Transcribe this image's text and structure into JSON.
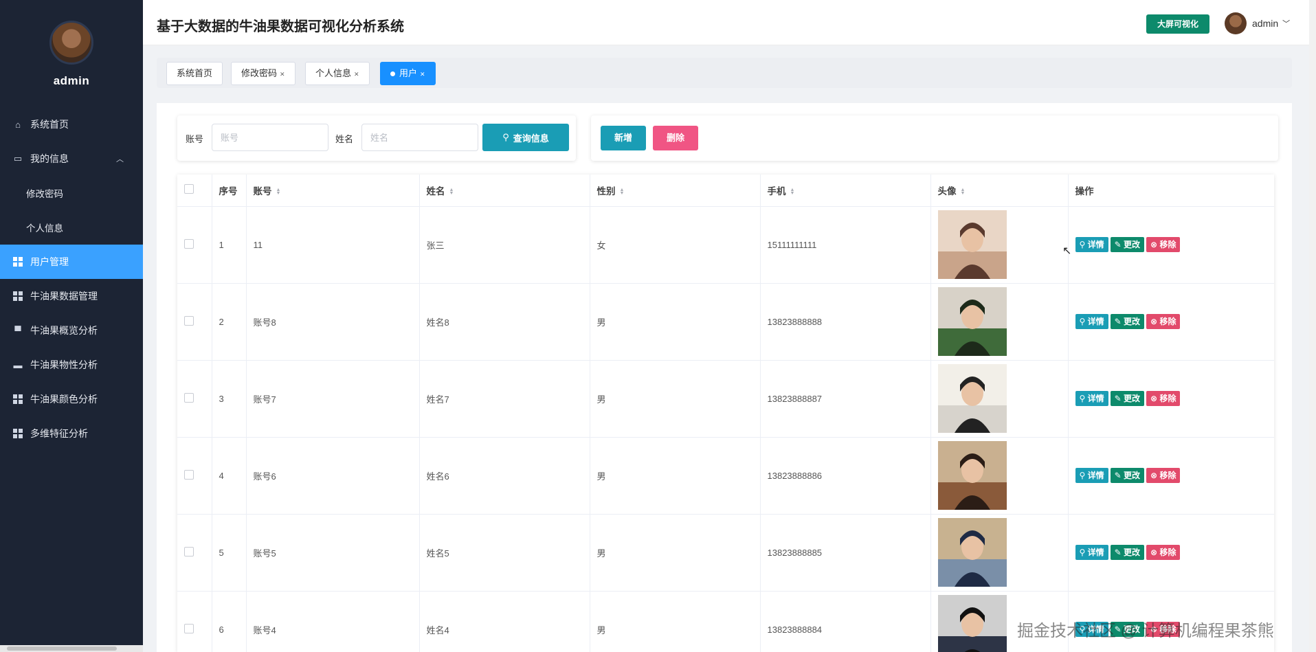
{
  "sidebar": {
    "username": "admin",
    "items": [
      {
        "label": "系统首页",
        "icon": "home-icon"
      },
      {
        "label": "我的信息",
        "icon": "card-icon"
      },
      {
        "label": "修改密码"
      },
      {
        "label": "个人信息"
      },
      {
        "label": "用户管理",
        "icon": "grid-icon"
      },
      {
        "label": "牛油果数据管理",
        "icon": "grid-icon"
      },
      {
        "label": "牛油果概览分析",
        "icon": "database-icon"
      },
      {
        "label": "牛油果物性分析",
        "icon": "briefcase-icon"
      },
      {
        "label": "牛油果颜色分析",
        "icon": "grid-icon"
      },
      {
        "label": "多维特征分析",
        "icon": "grid-icon"
      }
    ]
  },
  "header": {
    "title": "基于大数据的牛油果数据可视化分析系统",
    "big_screen_label": "大屏可视化",
    "username": "admin"
  },
  "tabs": [
    "系统首页",
    "修改密码",
    "个人信息",
    "用户"
  ],
  "search": {
    "account_label": "账号",
    "account_placeholder": "账号",
    "name_label": "姓名",
    "name_placeholder": "姓名",
    "query_label": "查询信息"
  },
  "actions": {
    "add_label": "新增",
    "delete_label": "删除"
  },
  "table": {
    "headers": [
      "序号",
      "账号",
      "姓名",
      "性别",
      "手机",
      "头像",
      "操作"
    ],
    "rows": [
      {
        "no": "1",
        "account": "11",
        "name": "张三",
        "gender": "女",
        "phone": "15111111111"
      },
      {
        "no": "2",
        "account": "账号8",
        "name": "姓名8",
        "gender": "男",
        "phone": "13823888888"
      },
      {
        "no": "3",
        "account": "账号7",
        "name": "姓名7",
        "gender": "男",
        "phone": "13823888887"
      },
      {
        "no": "4",
        "account": "账号6",
        "name": "姓名6",
        "gender": "男",
        "phone": "13823888886"
      },
      {
        "no": "5",
        "account": "账号5",
        "name": "姓名5",
        "gender": "男",
        "phone": "13823888885"
      },
      {
        "no": "6",
        "account": "账号4",
        "name": "姓名4",
        "gender": "男",
        "phone": "13823888884"
      }
    ],
    "ops": {
      "detail": "详情",
      "edit": "更改",
      "remove": "移除"
    }
  },
  "watermark": "掘金技术社区 @ 计算机编程果茶熊",
  "colors": {
    "sidebar_bg": "#1c2434",
    "active_menu": "#3aa1ff",
    "primary": "#1a9db5",
    "edit": "#0d8a6b",
    "danger": "#e24a6b",
    "delete": "#f05584"
  }
}
